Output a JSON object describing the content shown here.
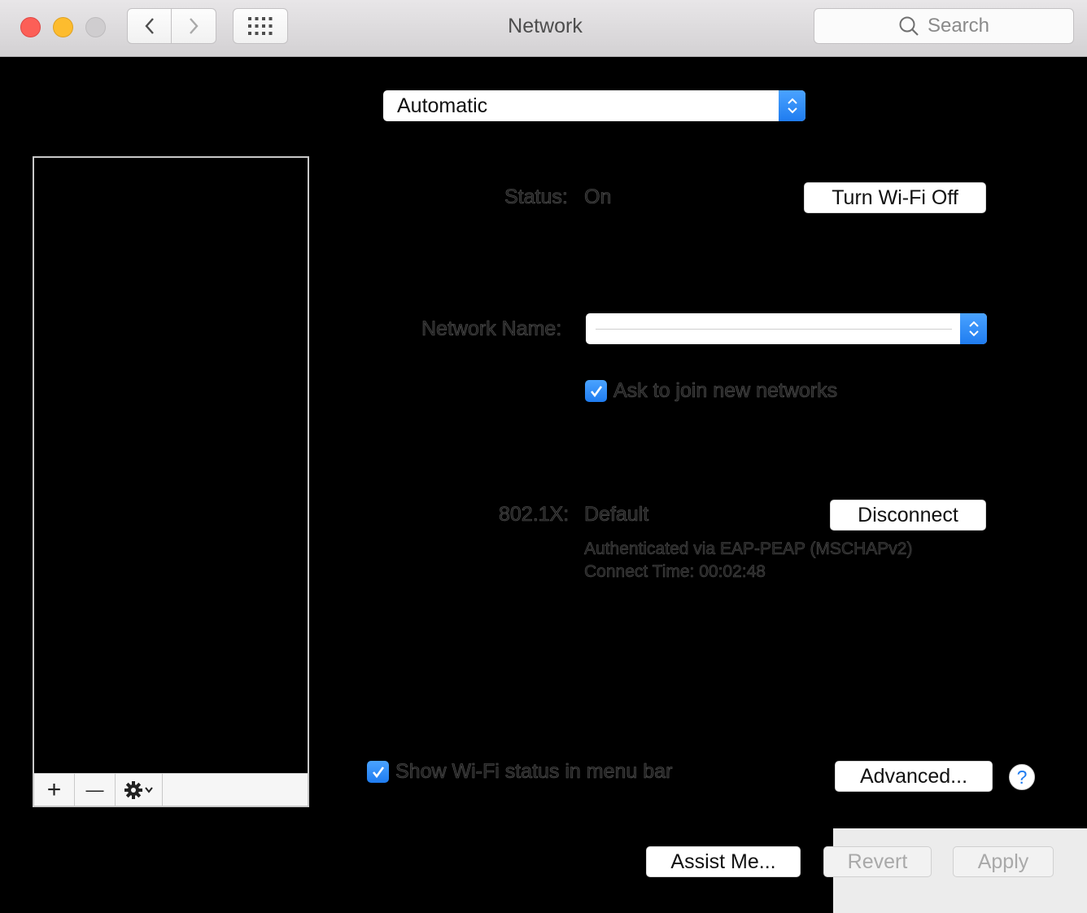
{
  "window": {
    "title": "Network",
    "search_placeholder": "Search"
  },
  "toolbar": {
    "back_icon": "chevron-left-icon",
    "forward_icon": "chevron-right-icon",
    "show_all_icon": "grid-icon"
  },
  "location": {
    "selected": "Automatic"
  },
  "status": {
    "label": "Status:",
    "value": "On",
    "toggle_button": "Turn Wi-Fi Off"
  },
  "network": {
    "label": "Network Name:",
    "selected": "",
    "ask_to_join_label": "Ask to join new networks",
    "ask_to_join_checked": true
  },
  "dot1x": {
    "label": "802.1X:",
    "value": "Default",
    "disconnect_button": "Disconnect",
    "auth_info": "Authenticated via EAP-PEAP (MSCHAPv2)",
    "connect_time": "Connect Time: 00:02:48"
  },
  "service_list": {
    "items": [],
    "add_label": "+",
    "remove_label": "—"
  },
  "footer": {
    "show_status_label": "Show Wi-Fi status in menu bar",
    "show_status_checked": true,
    "advanced_button": "Advanced...",
    "help_label": "?",
    "assist_button": "Assist Me...",
    "revert_button": "Revert",
    "apply_button": "Apply"
  },
  "colors": {
    "accent": "#1f7cf0",
    "background": "#000000"
  }
}
